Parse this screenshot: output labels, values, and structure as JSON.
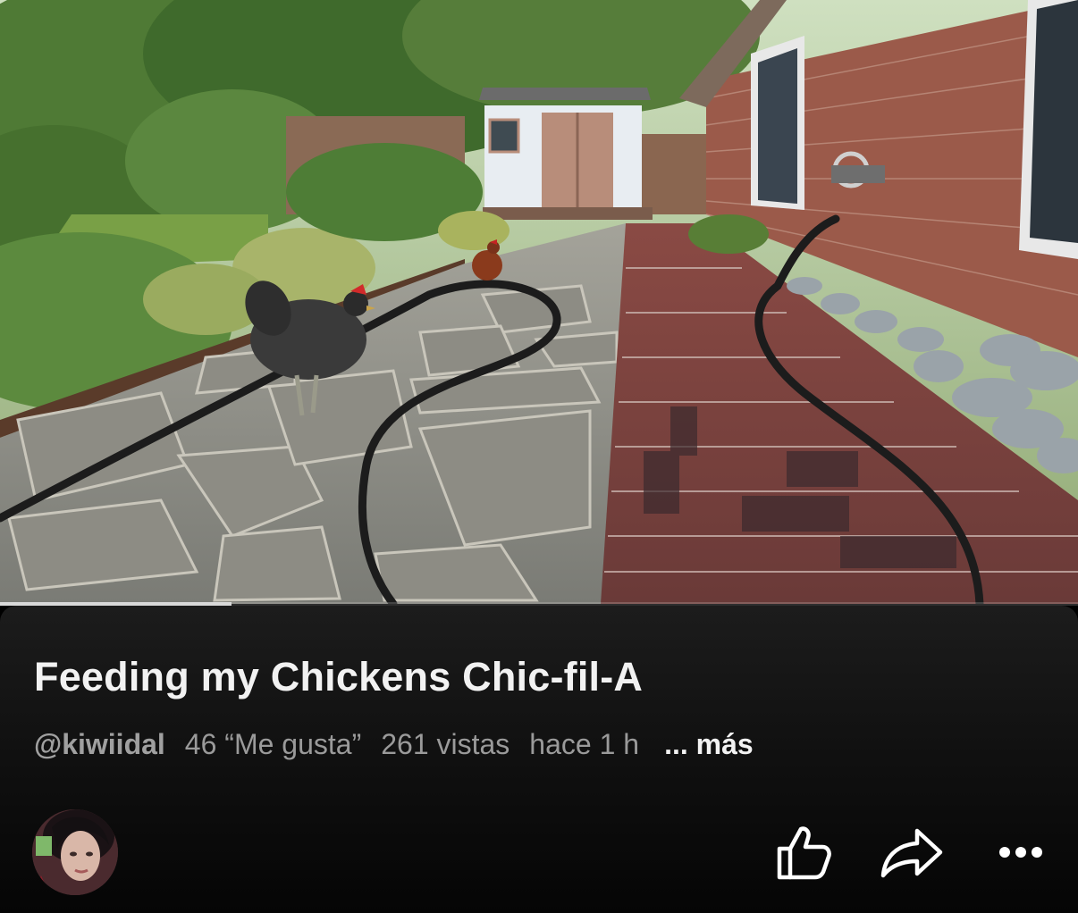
{
  "video": {
    "progress_fraction": 0.215
  },
  "info": {
    "title": "Feeding my Chickens Chic-fil-A",
    "handle": "@kiwiidal",
    "likes": "46 “Me gusta”",
    "views": "261 vistas",
    "time": "hace 1 h",
    "more": "... más"
  },
  "actions": {
    "like_icon": "thumbs-up-icon",
    "share_icon": "share-arrow-icon",
    "more_icon": "more-dots-icon"
  }
}
